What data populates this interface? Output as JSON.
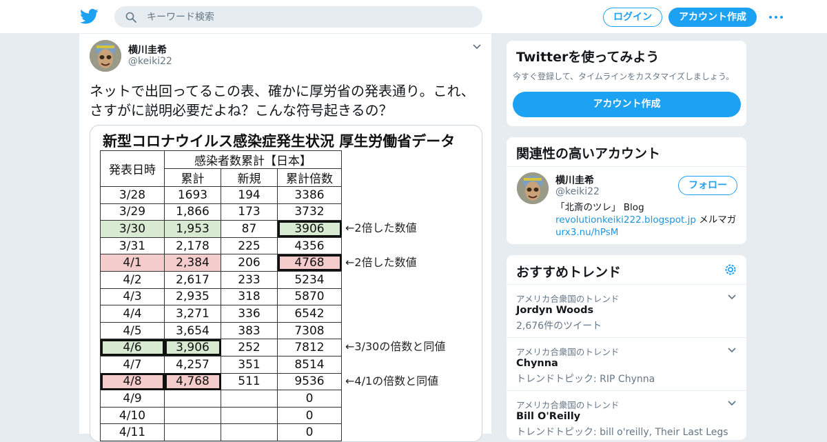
{
  "header": {
    "search_placeholder": "キーワード検索",
    "login_label": "ログイン",
    "signup_label": "アカウント作成",
    "brand_color": "#1da1f2"
  },
  "tweet": {
    "author_name": "横川圭希",
    "author_handle": "@keiki22",
    "text": "ネットで出回ってるこの表、確かに厚労省の発表通り。これ、さすがに説明必要だよね？こんな符号起きるの？",
    "media": {
      "title": "新型コロナウイルス感染症発生状況 厚生労働省データ",
      "header_date": "発表日時",
      "header_group": "感染者数累計【日本】",
      "header_cum": "累計",
      "header_new": "新規",
      "header_mult": "累計倍数",
      "rows": [
        {
          "date": "3/28",
          "cum": "1693",
          "new": "194",
          "mult": "3386"
        },
        {
          "date": "3/29",
          "cum": "1,866",
          "new": "173",
          "mult": "3732"
        },
        {
          "date": "3/30",
          "cum": "1,953",
          "new": "87",
          "mult": "3906"
        },
        {
          "date": "3/31",
          "cum": "2,178",
          "new": "225",
          "mult": "4356"
        },
        {
          "date": "4/1",
          "cum": "2,384",
          "new": "206",
          "mult": "4768"
        },
        {
          "date": "4/2",
          "cum": "2,617",
          "new": "233",
          "mult": "5234"
        },
        {
          "date": "4/3",
          "cum": "2,935",
          "new": "318",
          "mult": "5870"
        },
        {
          "date": "4/4",
          "cum": "3,271",
          "new": "336",
          "mult": "6542"
        },
        {
          "date": "4/5",
          "cum": "3,654",
          "new": "383",
          "mult": "7308"
        },
        {
          "date": "4/6",
          "cum": "3,906",
          "new": "252",
          "mult": "7812"
        },
        {
          "date": "4/7",
          "cum": "4,257",
          "new": "351",
          "mult": "8514"
        },
        {
          "date": "4/8",
          "cum": "4,768",
          "new": "511",
          "mult": "9536"
        },
        {
          "date": "4/9",
          "cum": "",
          "new": "",
          "mult": "0"
        },
        {
          "date": "4/10",
          "cum": "",
          "new": "",
          "mult": "0"
        },
        {
          "date": "4/11",
          "cum": "",
          "new": "",
          "mult": "0"
        }
      ],
      "notes": [
        "←2倍した数値",
        "←2倍した数値",
        "←3/30の倍数と同値",
        "←4/1の倍数と同値"
      ],
      "highlight_green": "#d9ead3",
      "highlight_red": "#f4cccc"
    }
  },
  "sidebar": {
    "signup_card": {
      "title": "Twitterを使ってみよう",
      "subtitle": "今すぐ登録して、タイムラインをカスタマイズしましょう。",
      "button": "アカウント作成"
    },
    "related": {
      "title": "関連性の高いアカウント",
      "name": "横川圭希",
      "handle": "@keiki22",
      "follow": "フォロー",
      "bio_prefix": "「北斎のツレ」 Blog",
      "bio_link1": "revolutionkeiki222.blogspot.jp",
      "bio_mid": " メルマガ",
      "bio_link2": "urx3.nu/hPsM"
    },
    "trends": {
      "title": "おすすめトレンド",
      "items": [
        {
          "context": "アメリカ合衆国のトレンド",
          "name": "Jordyn Woods",
          "meta": "2,676件のツイート"
        },
        {
          "context": "アメリカ合衆国のトレンド",
          "name": "Chynna",
          "meta": "トレンドトピック: RIP Chynna"
        },
        {
          "context": "アメリカ合衆国のトレンド",
          "name": "Bill O'Reilly",
          "meta": "トレンドトピック: bill o'reilly, Their Last Legs"
        }
      ]
    }
  }
}
